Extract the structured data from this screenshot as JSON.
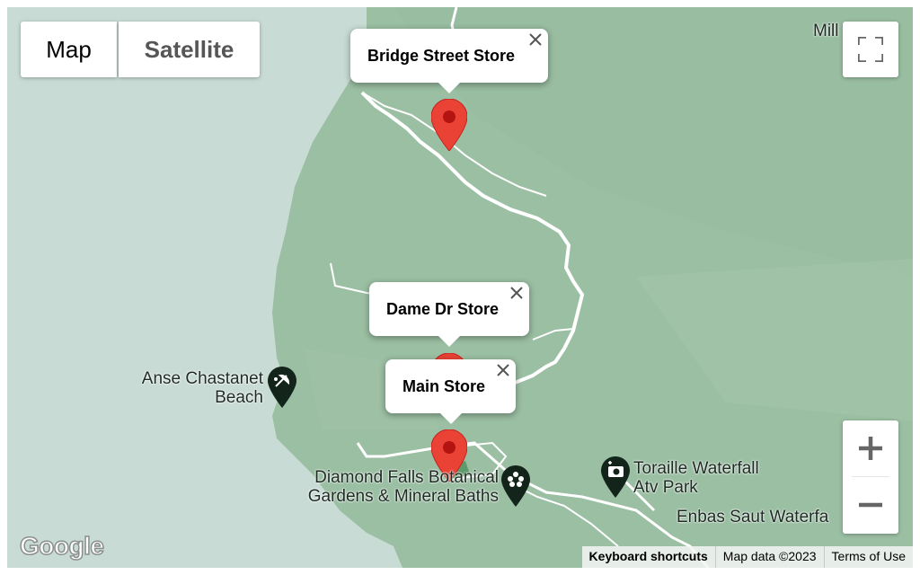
{
  "map_type_control": {
    "map_label": "Map",
    "satellite_label": "Satellite",
    "selected": "Map"
  },
  "markers": [
    {
      "title": "Bridge Street Store",
      "info_window_open": true
    },
    {
      "title": "Dame Dr Store",
      "info_window_open": true
    },
    {
      "title": "Main Store",
      "info_window_open": true
    }
  ],
  "pois": [
    {
      "label_line1": "Anse Chastanet",
      "label_line2": "Beach",
      "icon": "beach-umbrella-icon"
    },
    {
      "label_line1": "Diamond Falls Botanical",
      "label_line2": "Gardens & Mineral Baths",
      "icon": "flower-icon"
    },
    {
      "label_line1": "Toraille Waterfall",
      "label_line2": "Atv Park",
      "icon": "camera-icon"
    },
    {
      "label_line1": "Enbas Saut Waterfa",
      "label_line2": "",
      "icon": ""
    },
    {
      "label_line1": "Mill",
      "label_line2": "",
      "icon": ""
    }
  ],
  "footer": {
    "keyboard_shortcuts": "Keyboard shortcuts",
    "map_data": "Map data ©2023",
    "terms": "Terms of Use"
  },
  "logo": "Google",
  "colors": {
    "water": "#c8dbd4",
    "land": "#9bbfa3",
    "marker": "#ea4335",
    "poi": "#13251b"
  }
}
